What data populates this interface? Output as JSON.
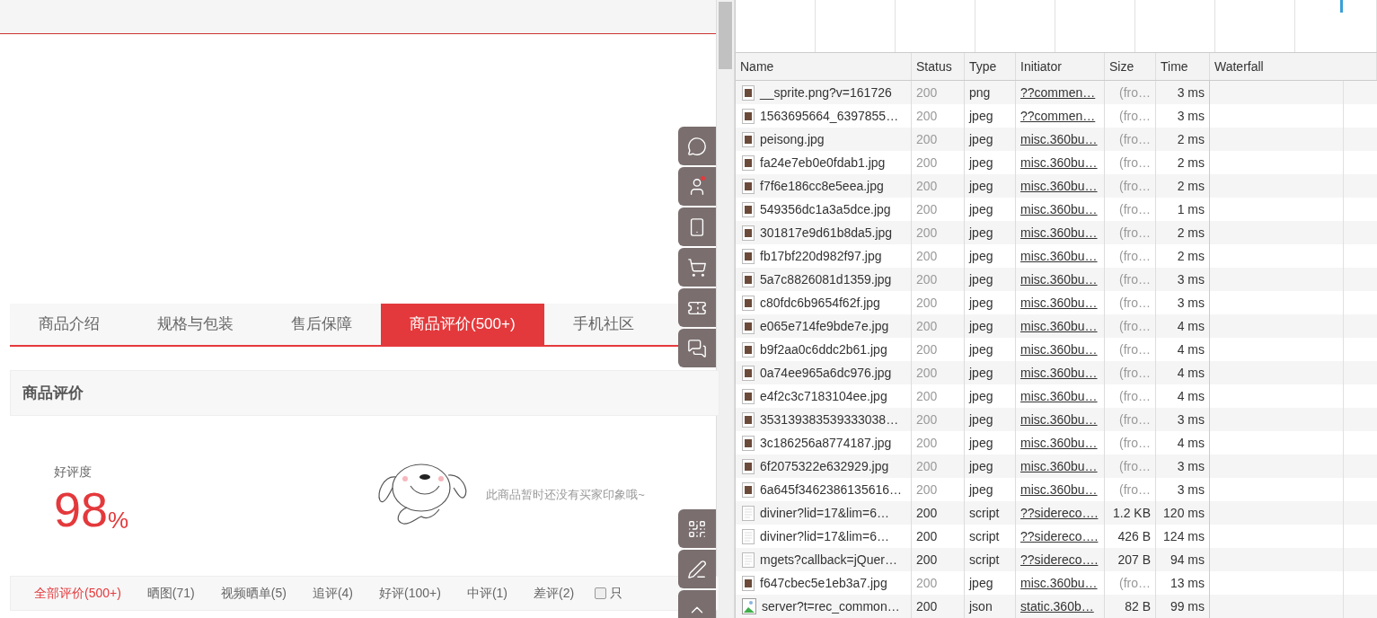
{
  "product_page": {
    "tabs": [
      {
        "label": "商品介绍",
        "selected": false
      },
      {
        "label": "规格与包装",
        "selected": false
      },
      {
        "label": "售后保障",
        "selected": false
      },
      {
        "label": "商品评价(500+)",
        "selected": true
      },
      {
        "label": "手机社区",
        "selected": false
      }
    ],
    "section_title": "商品评价",
    "rating": {
      "label": "好评度",
      "value": "98",
      "unit": "%"
    },
    "impression_note": "此商品暂时还没有买家印象哦~",
    "filters": [
      {
        "label": "全部评价(500+)",
        "selected": true
      },
      {
        "label": "晒图(71)",
        "selected": false
      },
      {
        "label": "视频晒单(5)",
        "selected": false
      },
      {
        "label": "追评(4)",
        "selected": false
      },
      {
        "label": "好评(100+)",
        "selected": false
      },
      {
        "label": "中评(1)",
        "selected": false
      },
      {
        "label": "差评(2)",
        "selected": false
      }
    ],
    "only_checkbox": {
      "label": "只",
      "checked": false
    }
  },
  "devtools": {
    "columns": [
      "Name",
      "Status",
      "Type",
      "Initiator",
      "Size",
      "Time",
      "Waterfall"
    ],
    "rows": [
      {
        "kind": "image",
        "name": "__sprite.png?v=161726",
        "status": "200",
        "type": "png",
        "initiator": "??commen…",
        "size": "(fro…",
        "time": "3 ms",
        "from_cache": true
      },
      {
        "kind": "image",
        "name": "1563695664_6397855…",
        "status": "200",
        "type": "jpeg",
        "initiator": "??commen…",
        "size": "(fro…",
        "time": "3 ms",
        "from_cache": true
      },
      {
        "kind": "image",
        "name": "peisong.jpg",
        "status": "200",
        "type": "jpeg",
        "initiator": "misc.360bu…",
        "size": "(fro…",
        "time": "2 ms",
        "from_cache": true
      },
      {
        "kind": "image",
        "name": "fa24e7eb0e0fdab1.jpg",
        "status": "200",
        "type": "jpeg",
        "initiator": "misc.360bu…",
        "size": "(fro…",
        "time": "2 ms",
        "from_cache": true
      },
      {
        "kind": "image",
        "name": "f7f6e186cc8e5eea.jpg",
        "status": "200",
        "type": "jpeg",
        "initiator": "misc.360bu…",
        "size": "(fro…",
        "time": "2 ms",
        "from_cache": true
      },
      {
        "kind": "image",
        "name": "549356dc1a3a5dce.jpg",
        "status": "200",
        "type": "jpeg",
        "initiator": "misc.360bu…",
        "size": "(fro…",
        "time": "1 ms",
        "from_cache": true
      },
      {
        "kind": "image",
        "name": "301817e9d61b8da5.jpg",
        "status": "200",
        "type": "jpeg",
        "initiator": "misc.360bu…",
        "size": "(fro…",
        "time": "2 ms",
        "from_cache": true
      },
      {
        "kind": "image",
        "name": "fb17bf220d982f97.jpg",
        "status": "200",
        "type": "jpeg",
        "initiator": "misc.360bu…",
        "size": "(fro…",
        "time": "2 ms",
        "from_cache": true
      },
      {
        "kind": "image",
        "name": "5a7c8826081d1359.jpg",
        "status": "200",
        "type": "jpeg",
        "initiator": "misc.360bu…",
        "size": "(fro…",
        "time": "3 ms",
        "from_cache": true
      },
      {
        "kind": "image",
        "name": "c80fdc6b9654f62f.jpg",
        "status": "200",
        "type": "jpeg",
        "initiator": "misc.360bu…",
        "size": "(fro…",
        "time": "3 ms",
        "from_cache": true
      },
      {
        "kind": "image",
        "name": "e065e714fe9bde7e.jpg",
        "status": "200",
        "type": "jpeg",
        "initiator": "misc.360bu…",
        "size": "(fro…",
        "time": "4 ms",
        "from_cache": true
      },
      {
        "kind": "image",
        "name": "b9f2aa0c6ddc2b61.jpg",
        "status": "200",
        "type": "jpeg",
        "initiator": "misc.360bu…",
        "size": "(fro…",
        "time": "4 ms",
        "from_cache": true
      },
      {
        "kind": "image",
        "name": "0a74ee965a6dc976.jpg",
        "status": "200",
        "type": "jpeg",
        "initiator": "misc.360bu…",
        "size": "(fro…",
        "time": "4 ms",
        "from_cache": true
      },
      {
        "kind": "image",
        "name": "e4f2c3c7183104ee.jpg",
        "status": "200",
        "type": "jpeg",
        "initiator": "misc.360bu…",
        "size": "(fro…",
        "time": "4 ms",
        "from_cache": true
      },
      {
        "kind": "image",
        "name": "353139383539333038…",
        "status": "200",
        "type": "jpeg",
        "initiator": "misc.360bu…",
        "size": "(fro…",
        "time": "3 ms",
        "from_cache": true
      },
      {
        "kind": "image",
        "name": "3c186256a8774187.jpg",
        "status": "200",
        "type": "jpeg",
        "initiator": "misc.360bu…",
        "size": "(fro…",
        "time": "4 ms",
        "from_cache": true
      },
      {
        "kind": "image",
        "name": "6f2075322e632929.jpg",
        "status": "200",
        "type": "jpeg",
        "initiator": "misc.360bu…",
        "size": "(fro…",
        "time": "3 ms",
        "from_cache": true
      },
      {
        "kind": "image",
        "name": "6a645f3462386135616…",
        "status": "200",
        "type": "jpeg",
        "initiator": "misc.360bu…",
        "size": "(fro…",
        "time": "3 ms",
        "from_cache": true
      },
      {
        "kind": "script",
        "name": "diviner?lid=17&lim=6…",
        "status": "200",
        "type": "script",
        "initiator": "??sidereco….",
        "size": "1.2 KB",
        "time": "120 ms",
        "from_cache": false
      },
      {
        "kind": "script",
        "name": "diviner?lid=17&lim=6…",
        "status": "200",
        "type": "script",
        "initiator": "??sidereco….",
        "size": "426 B",
        "time": "124 ms",
        "from_cache": false
      },
      {
        "kind": "script",
        "name": "mgets?callback=jQuer…",
        "status": "200",
        "type": "script",
        "initiator": "??sidereco….",
        "size": "207 B",
        "time": "94 ms",
        "from_cache": false
      },
      {
        "kind": "image",
        "name": "f647cbec5e1eb3a7.jpg",
        "status": "200",
        "type": "jpeg",
        "initiator": "misc.360bu…",
        "size": "(fro…",
        "time": "13 ms",
        "from_cache": true
      },
      {
        "kind": "json",
        "name": "server?t=rec_common…",
        "status": "200",
        "type": "json",
        "initiator": "static.360b…",
        "size": "82 B",
        "time": "99 ms",
        "from_cache": false
      }
    ]
  }
}
